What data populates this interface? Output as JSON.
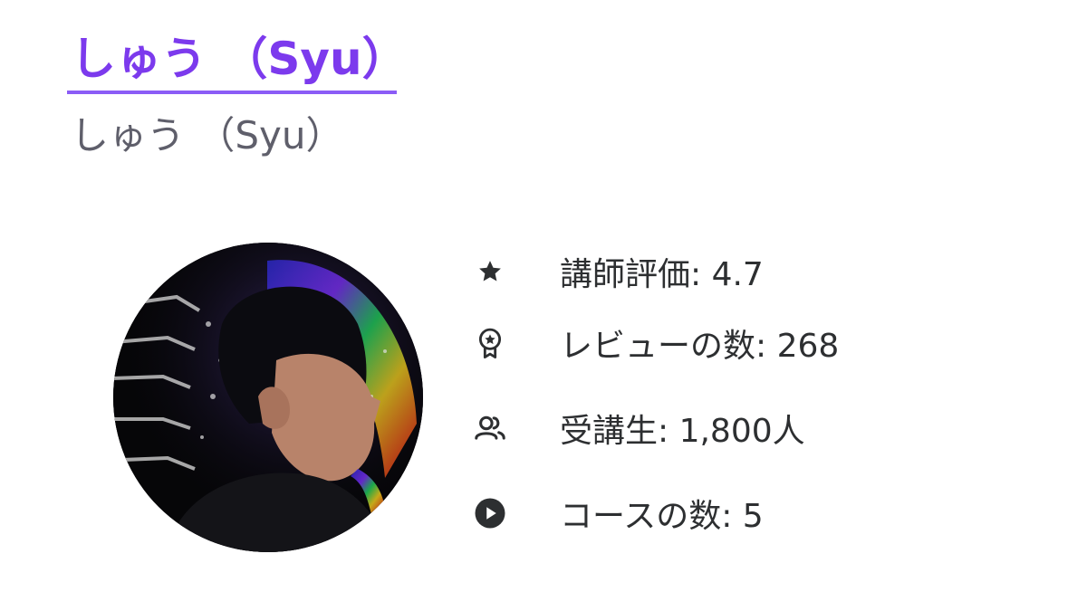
{
  "instructor": {
    "name": "しゅう （Syu）",
    "subtitle": "しゅう （Syu）"
  },
  "colors": {
    "accent": "#7c3aed",
    "underline": "#8b5cf6",
    "text": "#2d2f31",
    "subtext": "#5f5f6b"
  },
  "stats": [
    {
      "icon": "star-icon",
      "text": "講師評価: 4.7"
    },
    {
      "icon": "award-badge-icon",
      "text": "レビューの数: 268"
    },
    {
      "icon": "users-icon",
      "text": "受講生: 1,800人"
    },
    {
      "icon": "play-circle-icon",
      "text": "コースの数: 5"
    }
  ]
}
